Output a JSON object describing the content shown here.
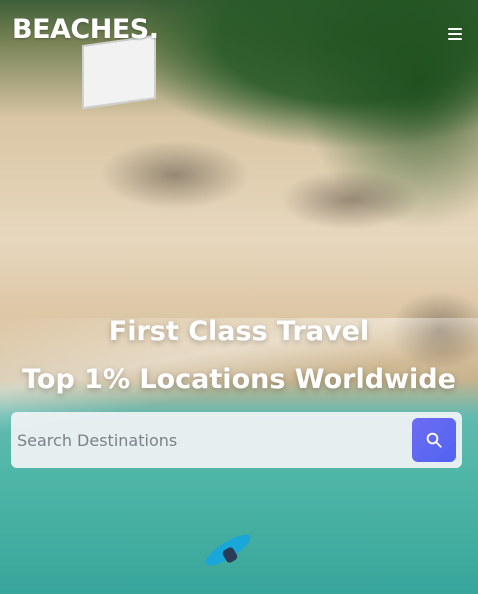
{
  "brand": {
    "name": "BEACHES."
  },
  "header": {
    "menu_icon": "hamburger-menu-icon"
  },
  "hero": {
    "headline_line1": "First Class Travel",
    "headline_line2": "Top 1% Locations Worldwide"
  },
  "search": {
    "placeholder": "Search Destinations",
    "value": "",
    "button_icon": "search-icon"
  },
  "colors": {
    "accent": "#5a66f1",
    "text_on_hero": "#ffffff",
    "search_bg": "#eef1f3"
  }
}
